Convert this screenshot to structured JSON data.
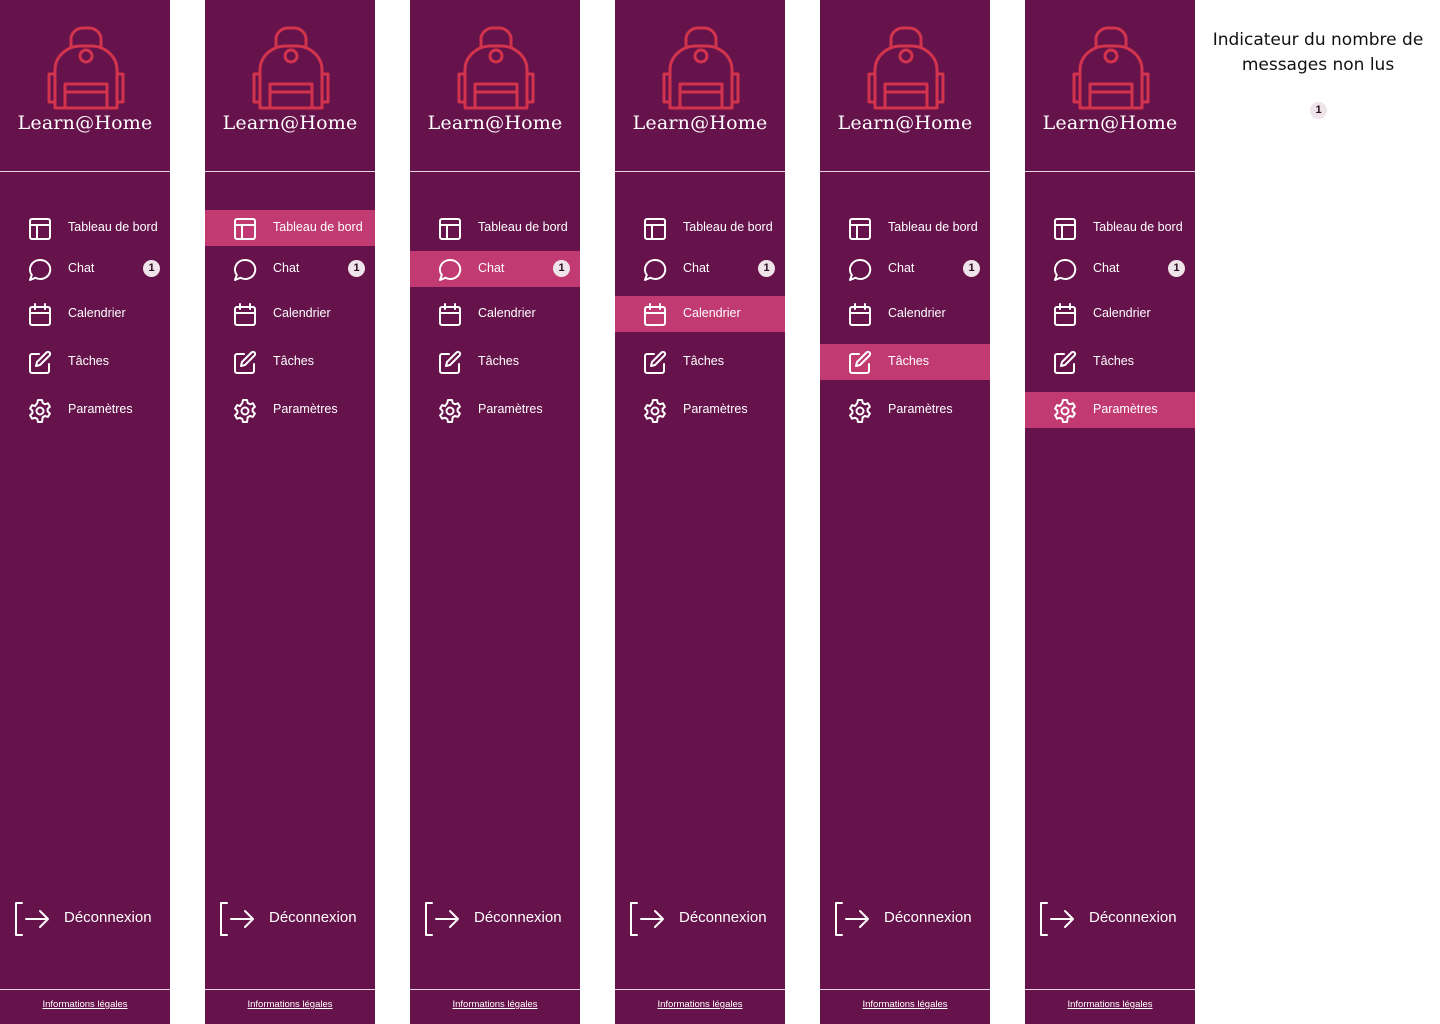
{
  "app": {
    "brand": "Learn@Home",
    "logo_icon": "backpack-icon"
  },
  "colors": {
    "sidebar_bg": "#66124b",
    "active_bg": "#c23a72",
    "logo_stroke": "#d2334d",
    "text": "#ffffff",
    "badge_bg": "#efe4e9"
  },
  "nav": {
    "items": [
      {
        "label": "Tableau de bord",
        "icon": "layout-icon"
      },
      {
        "label": "Chat",
        "icon": "chat-icon",
        "badge": "1"
      },
      {
        "label": "Calendrier",
        "icon": "calendar-icon"
      },
      {
        "label": "Tâches",
        "icon": "edit-icon"
      },
      {
        "label": "Paramètres",
        "icon": "gear-icon"
      }
    ]
  },
  "footer": {
    "logout_label": "Déconnexion",
    "logout_icon": "logout-icon",
    "legal_label": "Informations légales"
  },
  "variants": [
    {
      "active_item": null
    },
    {
      "active_item": "Tableau de bord"
    },
    {
      "active_item": "Chat"
    },
    {
      "active_item": "Calendrier"
    },
    {
      "active_item": "Tâches"
    },
    {
      "active_item": "Paramètres"
    }
  ],
  "annotation": {
    "text": "Indicateur du nombre de messages non lus",
    "badge": "1"
  }
}
